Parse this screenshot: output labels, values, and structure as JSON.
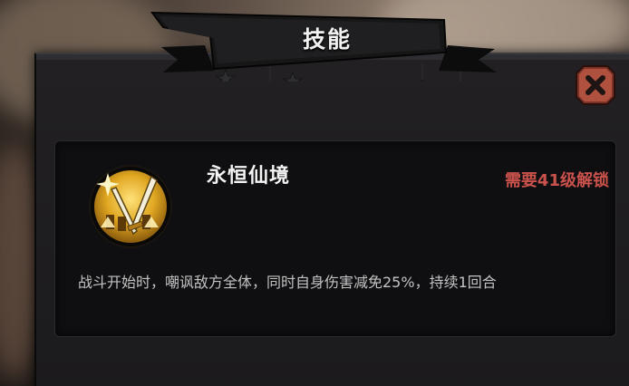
{
  "dialog": {
    "title": "技能",
    "close_icon": "close-x-icon"
  },
  "skill": {
    "icon": "crossed-swords-icon",
    "name": "永恒仙境",
    "unlock_requirement": "需要41级解锁",
    "description": "战斗开始时，嘲讽敌方全体，同时自身伤害减免25%，持续1回合"
  },
  "colors": {
    "panel_bg": "#1d1c1e",
    "card_bg": "#0f0e10",
    "unlock_red": "#c9524c",
    "close_button_bg": "#b0503f",
    "icon_gold": "#e0a722"
  }
}
